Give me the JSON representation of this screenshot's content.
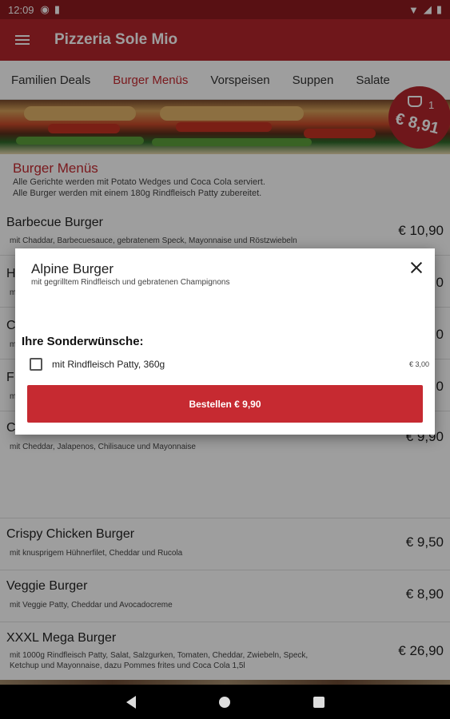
{
  "status_bar": {
    "time": "12:09"
  },
  "app_bar": {
    "title": "Pizzeria Sole Mio"
  },
  "tabs": [
    {
      "label": "Familien Deals"
    },
    {
      "label": "Burger Menüs"
    },
    {
      "label": "Vorspeisen"
    },
    {
      "label": "Suppen"
    },
    {
      "label": "Salate"
    }
  ],
  "cart": {
    "count": "1",
    "total": "€ 8,91"
  },
  "category": {
    "title": "Burger Menüs",
    "desc1": "Alle Gerichte werden mit Potato Wedges und Coca Cola serviert.",
    "desc2": "Alle Burger werden mit einem 180g Rindfleisch Patty zubereitet."
  },
  "items": [
    {
      "name": "Barbecue Burger",
      "desc": "mit Chaddar, Barbecuesauce, gebratenem Speck, Mayonnaise und Röstzwiebeln",
      "price": "€ 10,90"
    },
    {
      "name": "H",
      "desc": "m",
      "price": "0"
    },
    {
      "name": "C",
      "desc": "m",
      "price": "0"
    },
    {
      "name": "F",
      "desc": "m",
      "price": "0"
    },
    {
      "name": "C",
      "desc": "mit Cheddar, Jalapenos, Chilisauce und Mayonnaise",
      "price": "€ 9,90"
    },
    {
      "name": "Crispy Chicken Burger",
      "desc": "mit knusprigem Hühnerfilet, Cheddar und Rucola",
      "price": "€ 9,50"
    },
    {
      "name": "Veggie Burger",
      "desc": "mit Veggie Patty, Cheddar und Avocadocreme",
      "price": "€ 8,90"
    },
    {
      "name": "XXXL Mega Burger",
      "desc": "mit 1000g Rindfleisch Patty, Salat, Salzgurken, Tomaten, Cheddar, Zwiebeln, Speck, Ketchup und Mayonnaise, dazu Pommes frites und Coca Cola 1,5l",
      "price": "€ 26,90"
    }
  ],
  "dialog": {
    "title": "Alpine Burger",
    "subtitle": "mit gegrilltem Rindfleisch und gebratenen Champignons",
    "section": "Ihre Sonderwünsche:",
    "option_label": "mit Rindfleisch Patty, 360g",
    "option_price": "€ 3,00",
    "order_label": "Bestellen € 9,90"
  },
  "colors": {
    "brand": "#b4262d",
    "accent": "#c62a31"
  }
}
